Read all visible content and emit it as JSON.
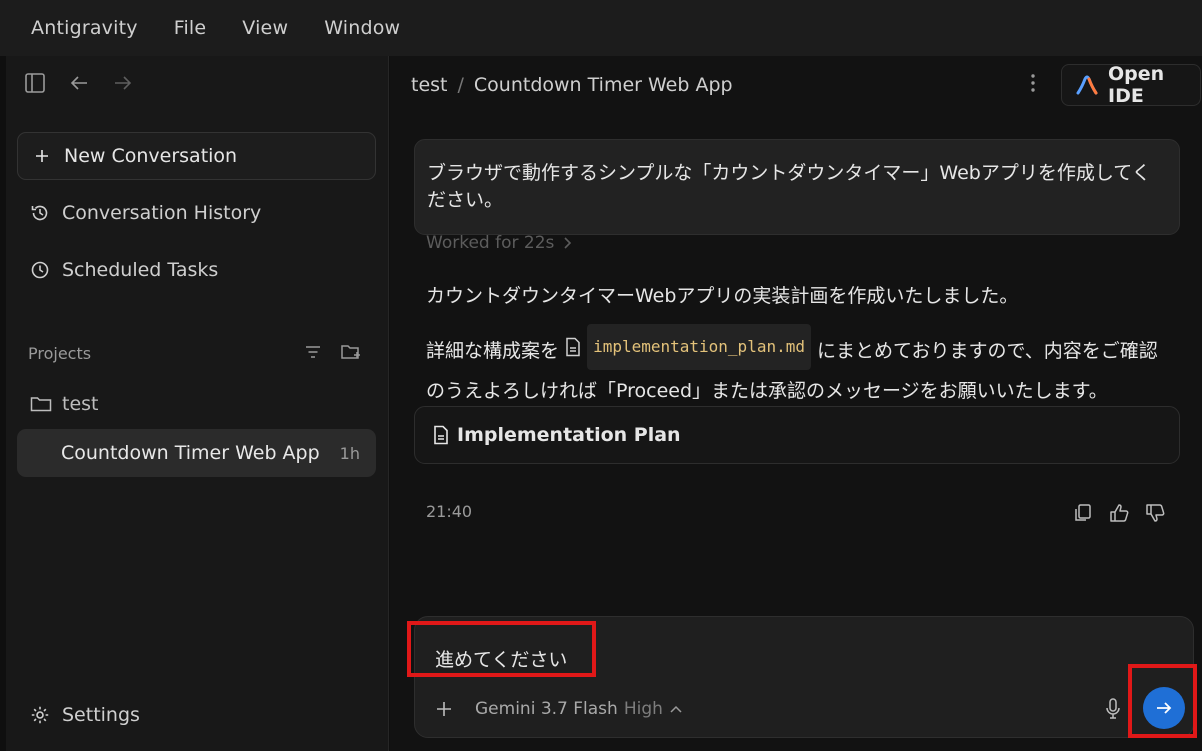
{
  "menubar": {
    "items": [
      "Antigravity",
      "File",
      "View",
      "Window"
    ]
  },
  "sidebar": {
    "new_conversation": "New Conversation",
    "nav": [
      "Conversation History",
      "Scheduled Tasks"
    ],
    "projects_header": "Projects",
    "project_folder": "test",
    "project_item": {
      "label": "Countdown Timer Web App",
      "age": "1h"
    },
    "settings": "Settings"
  },
  "header": {
    "breadcrumb_project": "test",
    "breadcrumb_separator": "/",
    "breadcrumb_title": "Countdown Timer Web App",
    "open_ide": "Open IDE"
  },
  "conversation": {
    "user_message": "ブラウザで動作するシンプルな「カウントダウンタイマー」Webアプリを作成してください。",
    "worked_for": "Worked for 22s",
    "response_line1": "カウントダウンタイマーWebアプリの実装計画を作成いたしました。",
    "response_pre": "詳細な構成案を",
    "response_file": "implementation_plan.md",
    "response_post": "にまとめておりますので、内容をご確認のうえよろしければ「Proceed」または承認のメッセージをお願いいたします。",
    "plan_card": "Implementation Plan",
    "timestamp": "21:40"
  },
  "composer": {
    "input_value": "進めてください",
    "model": "Gemini 3.7 Flash",
    "mode": "High"
  },
  "colors": {
    "accent": "#1f6fd6",
    "highlight": "#e01818"
  }
}
